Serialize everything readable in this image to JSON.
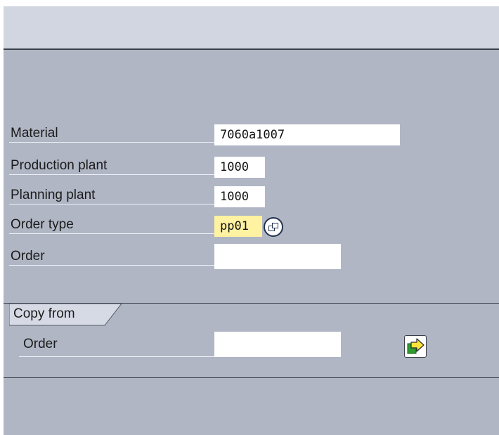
{
  "form": {
    "fields": [
      {
        "label": "Material",
        "value": "7060a1007"
      },
      {
        "label": "Production plant",
        "value": "1000"
      },
      {
        "label": "Planning plant",
        "value": "1000"
      },
      {
        "label": "Order type",
        "value": "pp01"
      },
      {
        "label": "Order",
        "value": ""
      }
    ]
  },
  "copy_from": {
    "title": "Copy from",
    "order_label": "Order",
    "order_value": ""
  },
  "colors": {
    "background": "#b0b6c4",
    "toolbar": "#d1d6e0",
    "required_field": "#fff2a0",
    "field": "#ffffff"
  },
  "icons": {
    "order_type_help": "possible-entries-icon",
    "execute": "execute-arrow-icon"
  }
}
